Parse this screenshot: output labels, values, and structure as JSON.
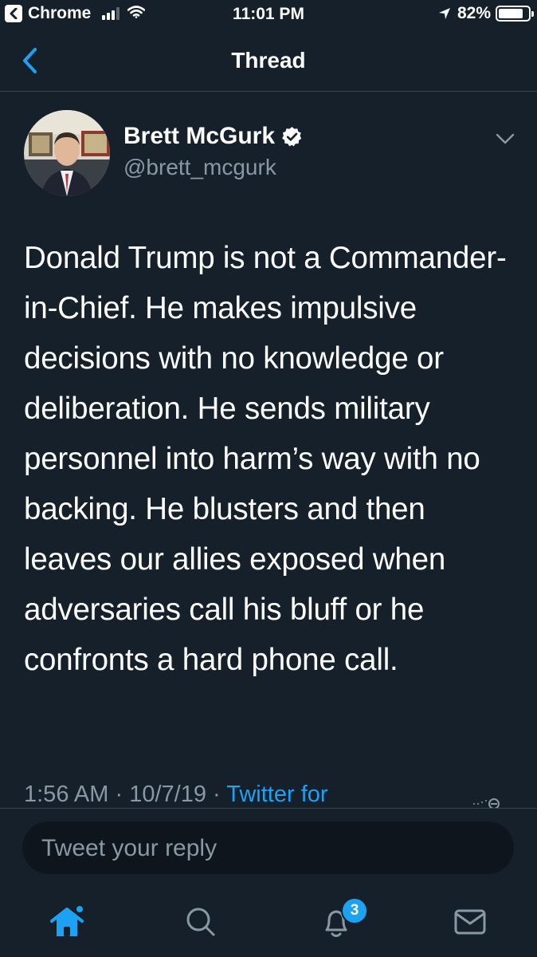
{
  "status_bar": {
    "back_app": "Chrome",
    "time": "11:01 PM",
    "battery_percent": "82%",
    "battery_level": 0.82,
    "icons": [
      "back-to-app-icon",
      "cellular-signal-icon",
      "wifi-icon",
      "location-arrow-icon",
      "battery-icon"
    ]
  },
  "nav": {
    "title": "Thread",
    "back_icon": "chevron-left-icon"
  },
  "tweet": {
    "author_name": "Brett McGurk",
    "author_handle": "@brett_mcgurk",
    "verified_icon": "verified-badge-icon",
    "menu_icon": "chevron-down-icon",
    "text": "Donald Trump is not a Commander-in-Chief. He makes impulsive decisions with no knowledge or deliberation. He sends military personnel into harm’s way with no backing. He blusters and then leaves our allies exposed when adversaries call his bluff or he confronts a hard phone call.",
    "time": "1:56 AM",
    "separator": "·",
    "date": "10/7/19",
    "source": "Twitter for"
  },
  "reply": {
    "placeholder": "Tweet your reply"
  },
  "tab_bar": {
    "tabs": [
      "home-icon",
      "search-icon",
      "notifications-icon",
      "messages-icon"
    ],
    "notifications_badge": "3"
  },
  "colors": {
    "background": "#15202b",
    "accent": "#1da1f2",
    "secondary_text": "#8899a6",
    "divider": "#38444d"
  }
}
